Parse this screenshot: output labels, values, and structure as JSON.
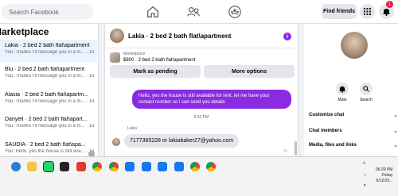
{
  "topbar": {
    "search_placeholder": "Search Facebook",
    "find_friends_label": "Find friends",
    "notification_count": "1"
  },
  "sidebar": {
    "title": "Marketplace",
    "threads": [
      {
        "title": "Lakia · 2 bed 2 bath flat\\apartment",
        "preview": "You: Thanks I'll message you in a m... · 1m"
      },
      {
        "title": "Blu · 2 bed 2 bath flat\\apartment",
        "preview": "You: Thanks I'll message you in a m... · 1m"
      },
      {
        "title": "Alasia · 2 bed 2 bath flat\\apartm...",
        "preview": "You: Thanks I'll message you in a m... · 1m"
      },
      {
        "title": "Danyell · 2 bed 2 bath flat\\apart...",
        "preview": "You: Thanks I'll message you in a m... · 1m"
      },
      {
        "title": "SAUDIA · 2 bed 2 bath flat\\apa...",
        "preview": "You: Hello, yes the house is still ava... · 1m"
      }
    ]
  },
  "chat": {
    "title": "Lakia · 2 bed 2 bath flat\\apartment",
    "listing_label": "Marketplace",
    "listing_desc": "$800 · 2 bed 2 bath flat\\apartment",
    "mark_pending_label": "Mark as pending",
    "more_options_label": "More options",
    "outgoing_message": "Hello, yes the house is still available for rent, let me have your contact number so i can send you details",
    "timestamp": "6:52 PM",
    "sender_name": "Lakia",
    "incoming_message": "7177365228 or lakiabaker27@yahoo.com"
  },
  "info_panel": {
    "mute_label": "Mute",
    "search_label": "Search",
    "rows": [
      "Customize chat",
      "Chat members",
      "Media, files and links"
    ]
  },
  "taskbar": {
    "time": "06:20 PM",
    "day": "Friday",
    "date": "6/12/20..."
  },
  "colors": {
    "accent": "#8a2be2",
    "active_thread": "#e7f3ff"
  }
}
